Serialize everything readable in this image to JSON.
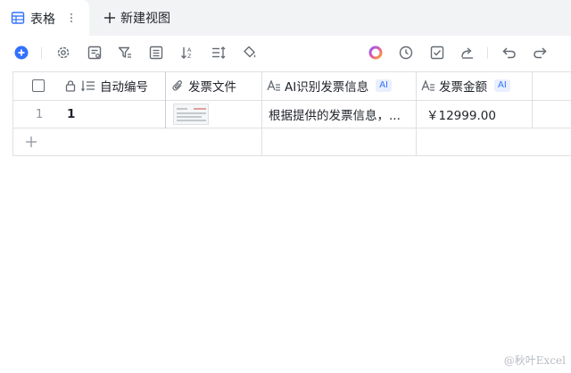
{
  "tabs": {
    "active_label": "表格",
    "new_view_label": "新建视图"
  },
  "toolbar": {
    "icons": [
      "add-record-icon",
      "settings-icon",
      "form-icon",
      "filter-icon",
      "group-icon",
      "sort-icon",
      "row-height-icon",
      "fill-color-icon",
      "ai-assistant-icon",
      "history-icon",
      "checklist-icon",
      "share-icon",
      "undo-icon",
      "redo-icon"
    ]
  },
  "grid": {
    "columns": [
      {
        "label": "自动编号",
        "icon": "auto-number-icon",
        "locked": true
      },
      {
        "label": "发票文件",
        "icon": "attachment-icon"
      },
      {
        "label": "AI识别发票信息",
        "icon": "ai-text-icon",
        "badge": "AI"
      },
      {
        "label": "发票金额",
        "icon": "ai-text-icon",
        "badge": "AI"
      }
    ],
    "rows": [
      {
        "index": "1",
        "auto_number": "1",
        "file_thumb": "invoice-thumbnail",
        "ai_info": "根据提供的发票信息，...",
        "amount": "￥12999.00"
      }
    ],
    "add_row_icon": "plus-icon"
  },
  "colors": {
    "accent": "#3370ff",
    "tabbar_bg": "#f2f3f5",
    "grid_line": "#dee0e3",
    "ai_badge_bg": "#e8effe"
  },
  "watermark": "@秋叶Excel"
}
